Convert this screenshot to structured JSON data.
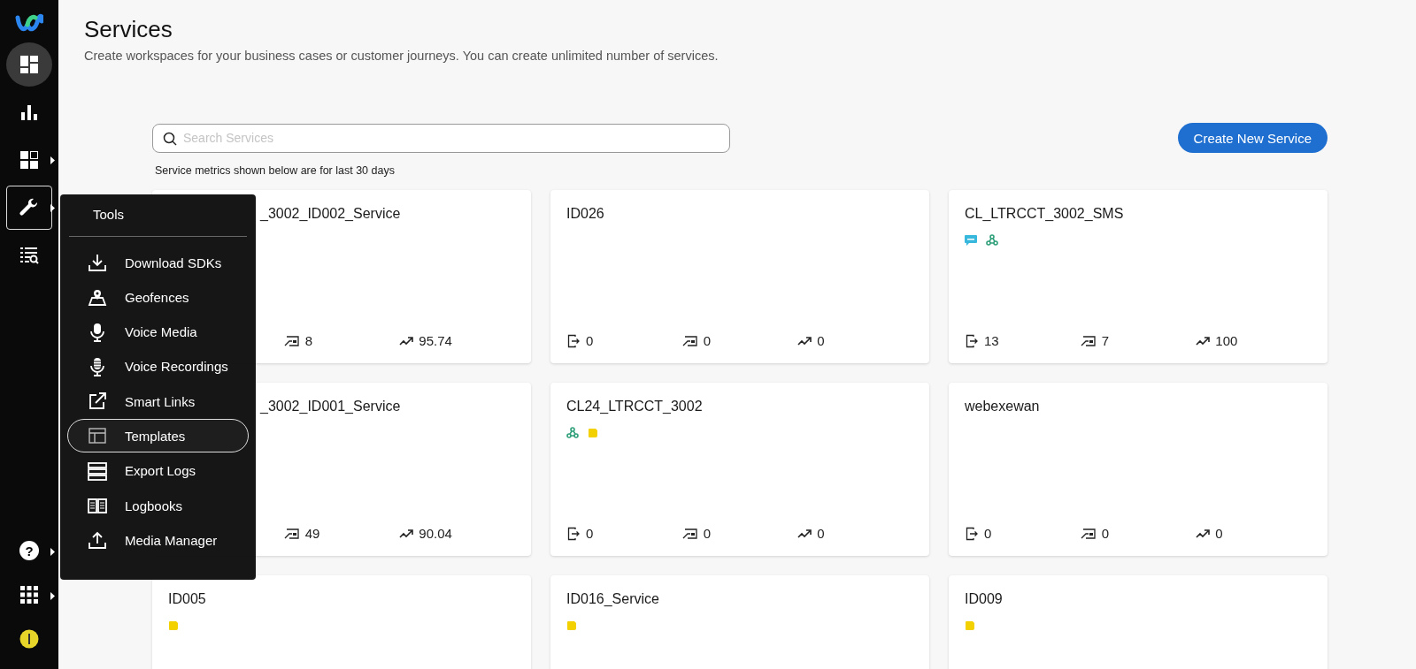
{
  "sidebar": {
    "items": [
      {
        "kind": "dashboard",
        "selected": true,
        "expanded": false,
        "submenu": false
      },
      {
        "kind": "analytics",
        "selected": false,
        "expanded": false,
        "submenu": false
      },
      {
        "kind": "apps",
        "selected": false,
        "expanded": false,
        "submenu": true
      },
      {
        "kind": "tools",
        "selected": false,
        "expanded": true,
        "submenu": true
      },
      {
        "kind": "logs",
        "selected": false,
        "expanded": false,
        "submenu": false
      }
    ],
    "bottom_items": [
      {
        "kind": "help",
        "submenu": true,
        "label": "?"
      },
      {
        "kind": "grid",
        "submenu": true
      },
      {
        "kind": "avatar",
        "submenu": false
      }
    ]
  },
  "header": {
    "title": "Services",
    "subtitle": "Create workspaces for your business cases or customer journeys. You can create unlimited number of services."
  },
  "search": {
    "placeholder": "Search Services"
  },
  "create_button": "Create New Service",
  "metrics_note": "Service metrics shown below are for last 30 days",
  "cards": [
    {
      "title": "_3002_ID002_Service",
      "partly_covered": true,
      "metrics": [
        {
          "kind": "transfers",
          "value": "8"
        },
        {
          "kind": "trend",
          "value": "95.74"
        }
      ]
    },
    {
      "title": "ID026",
      "metrics": [
        {
          "kind": "entries",
          "value": "0"
        },
        {
          "kind": "transfers",
          "value": "0"
        },
        {
          "kind": "trend",
          "value": "0"
        }
      ]
    },
    {
      "title": "CL_LTRCCT_3002_SMS",
      "tags": [
        {
          "kind": "sms"
        },
        {
          "kind": "webhook"
        }
      ],
      "metrics": [
        {
          "kind": "entries",
          "value": "13"
        },
        {
          "kind": "transfers",
          "value": "7"
        },
        {
          "kind": "trend",
          "value": "100"
        }
      ]
    },
    {
      "title": "_3002_ID001_Service",
      "partly_covered": true,
      "metrics": [
        {
          "kind": "transfers",
          "value": "49"
        },
        {
          "kind": "trend",
          "value": "90.04"
        }
      ]
    },
    {
      "title": "CL24_LTRCCT_3002",
      "tags": [
        {
          "kind": "webhook"
        },
        {
          "kind": "note"
        }
      ],
      "metrics": [
        {
          "kind": "entries",
          "value": "0"
        },
        {
          "kind": "transfers",
          "value": "0"
        },
        {
          "kind": "trend",
          "value": "0"
        }
      ]
    },
    {
      "title": "webexewan",
      "metrics": [
        {
          "kind": "entries",
          "value": "0"
        },
        {
          "kind": "transfers",
          "value": "0"
        },
        {
          "kind": "trend",
          "value": "0"
        }
      ]
    },
    {
      "title": "ID005",
      "tags": [
        {
          "kind": "note"
        }
      ]
    },
    {
      "title": "ID016_Service",
      "tags": [
        {
          "kind": "note"
        }
      ]
    },
    {
      "title": "ID009",
      "tags": [
        {
          "kind": "note"
        }
      ]
    }
  ],
  "tools_menu": {
    "title": "Tools",
    "items": [
      {
        "kind": "download",
        "label": "Download SDKs",
        "selected": false
      },
      {
        "kind": "map",
        "label": "Geofences",
        "selected": false
      },
      {
        "kind": "mic",
        "label": "Voice Media",
        "selected": false
      },
      {
        "kind": "recorder",
        "label": "Voice Recordings",
        "selected": false
      },
      {
        "kind": "external",
        "label": "Smart Links",
        "selected": false
      },
      {
        "kind": "template",
        "label": "Templates",
        "selected": true
      },
      {
        "kind": "server",
        "label": "Export Logs",
        "selected": false
      },
      {
        "kind": "book",
        "label": "Logbooks",
        "selected": false
      },
      {
        "kind": "upload",
        "label": "Media Manager",
        "selected": false
      }
    ]
  }
}
